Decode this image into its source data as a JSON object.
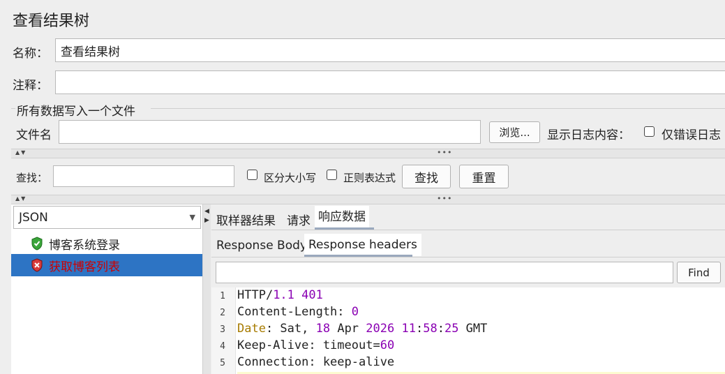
{
  "page": {
    "title": "查看结果树",
    "name_label": "名称：",
    "name_value": "查看结果树",
    "comment_label": "注释："
  },
  "file_section": {
    "legend": "所有数据写入一个文件",
    "filename_label": "文件名",
    "filename_value": "",
    "browse_button": "浏览...",
    "log_label": "显示日志内容：",
    "errors_only_label": "仅错误日志"
  },
  "search": {
    "label": "查找：",
    "value": "",
    "case_sensitive_label": "区分大小写",
    "regex_label": "正则表达式",
    "find_button": "查找",
    "reset_button": "重置"
  },
  "left_panel": {
    "renderer_selected": "JSON",
    "tree_items": [
      {
        "label": "博客系统登录",
        "status": "success",
        "selected": false
      },
      {
        "label": "获取博客列表",
        "status": "error",
        "selected": true
      }
    ]
  },
  "right_panel": {
    "tabs": [
      {
        "label": "取样器结果",
        "active": false
      },
      {
        "label": "请求",
        "active": false
      },
      {
        "label": "响应数据",
        "active": true
      }
    ],
    "subtabs": [
      {
        "label": "Response Body",
        "active": false
      },
      {
        "label": "Response headers",
        "active": true
      }
    ],
    "find_value": "",
    "find_button": "Find",
    "lines": [
      {
        "num": "1",
        "text": "HTTP/1.1 401"
      },
      {
        "num": "2",
        "text": "Content-Length: 0"
      },
      {
        "num": "3",
        "text": "Date: Sat, 18 Apr 2026 11:58:25 GMT"
      },
      {
        "num": "4",
        "text": "Keep-Alive: timeout=60"
      },
      {
        "num": "5",
        "text": "Connection: keep-alive"
      }
    ]
  },
  "colors": {
    "selection": "#2d74c4",
    "error_text": "#cc0000",
    "number": "#8a00b3",
    "date_key": "#a77b00",
    "tab_underline": "#9aa8bd"
  }
}
